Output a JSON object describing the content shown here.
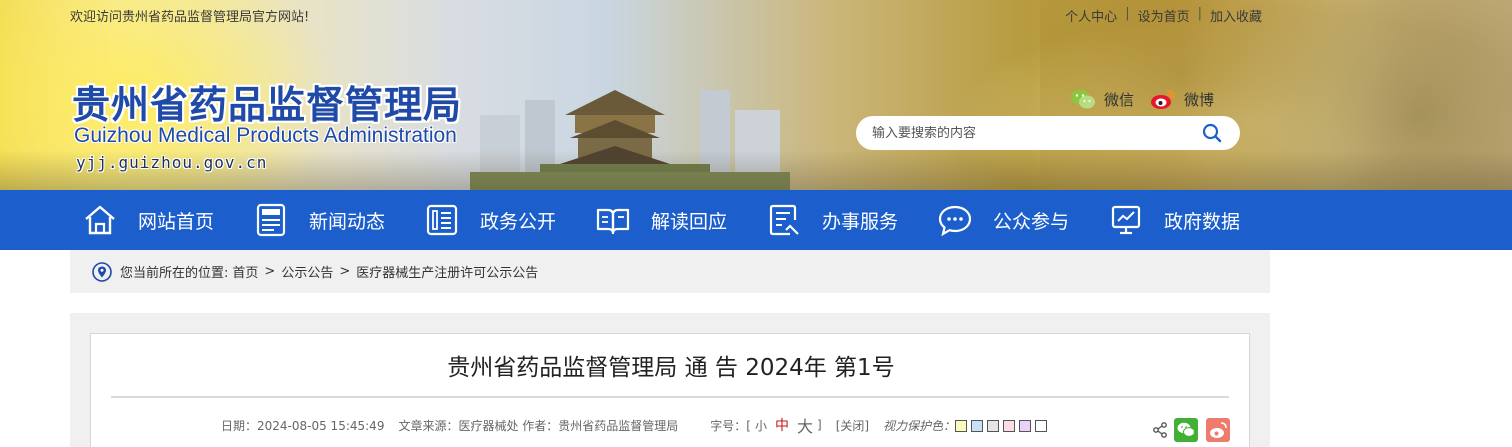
{
  "topbar": {
    "welcome": "欢迎访问贵州省药品监督管理局官方网站!",
    "links": [
      "个人中心",
      "设为首页",
      "加入收藏"
    ],
    "separator": "|"
  },
  "logo": {
    "cn": "贵州省药品监督管理局",
    "en": "Guizhou Medical Products Administration",
    "url": "yjj.guizhou.gov.cn"
  },
  "social": {
    "wechat": "微信",
    "weibo": "微博"
  },
  "search": {
    "placeholder": "输入要搜索的内容"
  },
  "nav": {
    "items": [
      {
        "label": "网站首页",
        "icon": "home-icon"
      },
      {
        "label": "新闻动态",
        "icon": "newspaper-icon"
      },
      {
        "label": "政务公开",
        "icon": "document-icon"
      },
      {
        "label": "解读回应",
        "icon": "open-book-icon"
      },
      {
        "label": "办事服务",
        "icon": "form-icon"
      },
      {
        "label": "公众参与",
        "icon": "chat-bubble-icon"
      },
      {
        "label": "政府数据",
        "icon": "chart-monitor-icon"
      }
    ]
  },
  "breadcrumb": {
    "prefix": "您当前所在的位置:",
    "items": [
      "首页",
      "公示公告",
      "医疗器械生产注册许可公示公告"
    ],
    "separator": ">"
  },
  "article": {
    "title": "贵州省药品监督管理局 通 告 2024年 第1号",
    "date": "日期：2024-08-05 15:45:49",
    "source": "文章来源：医疗器械处 作者：贵州省药品监督管理局",
    "font_size_label": "字号：[",
    "font_small": "小",
    "font_medium": "中",
    "font_large": "大",
    "font_close_bracket": "]",
    "close": "[关闭]",
    "eye_care_label": "视力保护色：",
    "eye_care_colors": [
      "#fafabe",
      "#c8e2f5",
      "#e5e5e5",
      "#fcdde6",
      "#e9d2f7",
      "#ffffff"
    ]
  },
  "colors": {
    "nav_bg": "#1c5fcc",
    "logo_blue": "#1f4aa8",
    "accent_red": "#c8161d"
  }
}
